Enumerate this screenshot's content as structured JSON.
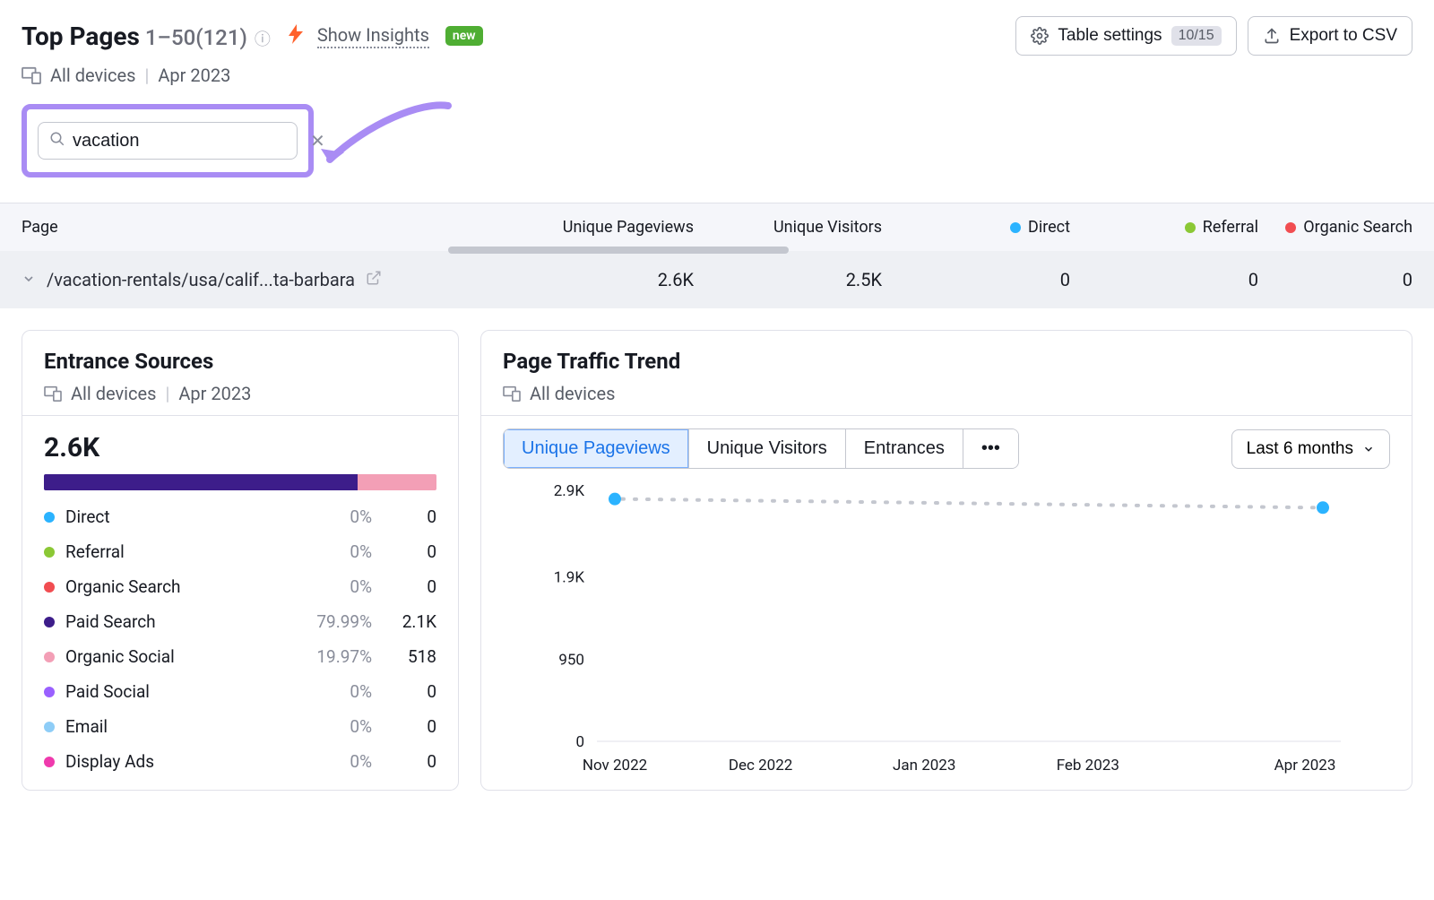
{
  "header": {
    "title": "Top Pages",
    "count_range": "1–50(121)",
    "show_insights": "Show Insights",
    "new_badge": "new",
    "table_settings": "Table settings",
    "table_settings_count": "10/15",
    "export": "Export to CSV",
    "all_devices": "All devices",
    "date": "Apr 2023"
  },
  "search": {
    "value": "vacation"
  },
  "table": {
    "columns": {
      "page": "Page",
      "unique_pageviews": "Unique Pageviews",
      "unique_visitors": "Unique Visitors",
      "direct": "Direct",
      "referral": "Referral",
      "organic": "Organic Search"
    },
    "row": {
      "path": "/vacation-rentals/usa/calif...ta-barbara",
      "unique_pageviews": "2.6K",
      "unique_visitors": "2.5K",
      "direct": "0",
      "referral": "0",
      "organic": "0"
    }
  },
  "entrance": {
    "title": "Entrance Sources",
    "all_devices": "All devices",
    "date": "Apr 2023",
    "total": "2.6K",
    "segments": {
      "paid_pct": 80,
      "organic_pct": 20
    },
    "items": [
      {
        "label": "Direct",
        "pct": "0%",
        "value": "0",
        "color": "dot-blue"
      },
      {
        "label": "Referral",
        "pct": "0%",
        "value": "0",
        "color": "dot-green"
      },
      {
        "label": "Organic Search",
        "pct": "0%",
        "value": "0",
        "color": "dot-red"
      },
      {
        "label": "Paid Search",
        "pct": "79.99%",
        "value": "2.1K",
        "color": "dot-purple"
      },
      {
        "label": "Organic Social",
        "pct": "19.97%",
        "value": "518",
        "color": "dot-pink"
      },
      {
        "label": "Paid Social",
        "pct": "0%",
        "value": "0",
        "color": "dot-violet"
      },
      {
        "label": "Email",
        "pct": "0%",
        "value": "0",
        "color": "dot-lblue"
      },
      {
        "label": "Display Ads",
        "pct": "0%",
        "value": "0",
        "color": "dot-mag"
      }
    ]
  },
  "trend": {
    "title": "Page Traffic Trend",
    "all_devices": "All devices",
    "tabs": [
      "Unique Pageviews",
      "Unique Visitors",
      "Entrances"
    ],
    "active_tab": 0,
    "range": "Last 6 months"
  },
  "chart_data": {
    "type": "line",
    "title": "Page Traffic Trend",
    "xlabel": "",
    "ylabel": "",
    "ylim": [
      0,
      2900
    ],
    "yticks": [
      0,
      950,
      1900,
      2900
    ],
    "ytick_labels": [
      "0",
      "950",
      "1.9K",
      "2.9K"
    ],
    "x_labels": [
      "Nov 2022",
      "Dec 2022",
      "Jan 2023",
      "Feb 2023",
      "Apr 2023"
    ],
    "series": [
      {
        "name": "Unique Pageviews",
        "points": [
          {
            "x": "Nov 2022",
            "y": 2800
          },
          {
            "x": "Apr 2023",
            "y": 2700
          }
        ],
        "dashed_between": true,
        "color": "#2bb3ff"
      }
    ]
  }
}
